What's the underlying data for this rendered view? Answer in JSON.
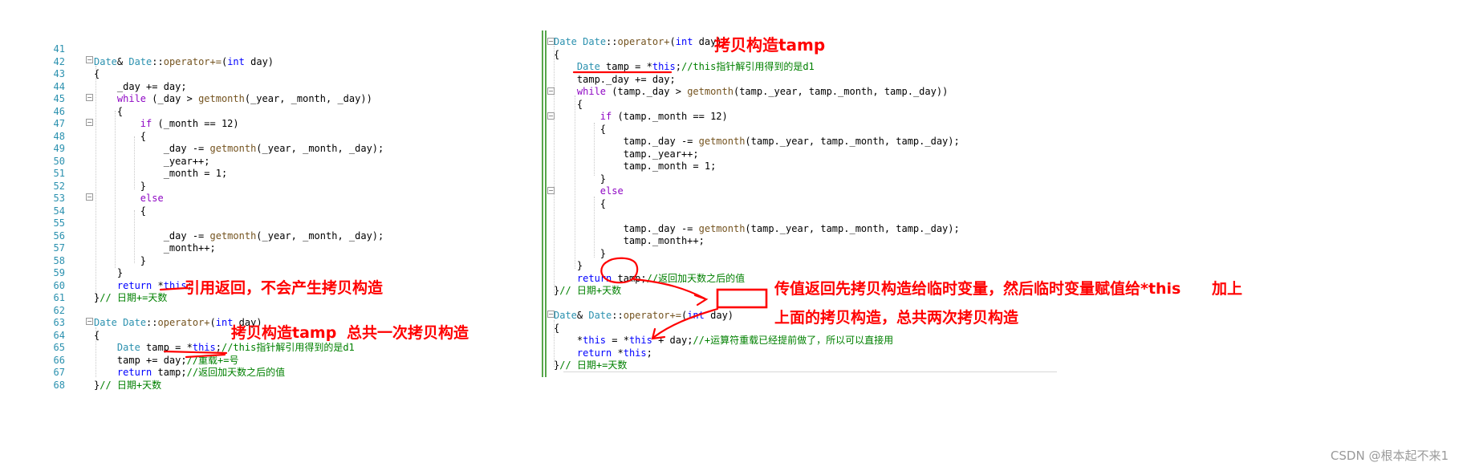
{
  "left": {
    "line_numbers": [
      "41",
      "42",
      "43",
      "44",
      "45",
      "46",
      "47",
      "48",
      "49",
      "50",
      "51",
      "52",
      "53",
      "54",
      "55",
      "56",
      "57",
      "58",
      "59",
      "60",
      "61",
      "62",
      "63",
      "64",
      "65",
      "66",
      "67",
      "68"
    ],
    "code": [
      "",
      "Date& Date::operator+=(int day)",
      "{",
      "    _day += day;",
      "    while (_day > getmonth(_year, _month, _day))",
      "    {",
      "        if (_month == 12)",
      "        {",
      "            _day -= getmonth(_year, _month, _day);",
      "            _year++;",
      "            _month = 1;",
      "        }",
      "        else",
      "        {",
      "",
      "            _day -= getmonth(_year, _month, _day);",
      "            _month++;",
      "        }",
      "    }",
      "    return *this;",
      "}// 日期+=天数",
      "",
      "Date Date::operator+(int day)",
      "{",
      "    Date tamp = *this;//this指针解引用得到的是d1",
      "    tamp += day;//重载+=号",
      "    return tamp;//返回加天数之后的值",
      "}// 日期+天数"
    ]
  },
  "right": {
    "code": [
      "Date Date::operator+(int day)",
      "{",
      "    Date tamp = *this;//this指针解引用得到的是d1",
      "    tamp._day += day;",
      "    while (tamp._day > getmonth(tamp._year, tamp._month, tamp._day))",
      "    {",
      "        if (tamp._month == 12)",
      "        {",
      "            tamp._day -= getmonth(tamp._year, tamp._month, tamp._day);",
      "            tamp._year++;",
      "            tamp._month = 1;",
      "        }",
      "        else",
      "        {",
      "",
      "            tamp._day -= getmonth(tamp._year, tamp._month, tamp._day);",
      "            tamp._month++;",
      "        }",
      "    }",
      "    return tamp;//返回加天数之后的值",
      "}// 日期+天数",
      "",
      "Date& Date::operator+=(int day)",
      "{",
      "    *this = *this + day;//+运算符重载已经提前做了，所以可以直接用",
      "    return *this;",
      "}// 日期+=天数"
    ]
  },
  "annotations": {
    "ref_return": "引用返回，不会产生拷贝构造",
    "copy_tamp_left": "拷贝构造tamp",
    "copy_once": "总共一次拷贝构造",
    "copy_tamp_right": "拷贝构造tamp",
    "value_return_1": "传值返回先拷贝构造给临时变量，然后临时变量赋值给*this",
    "add_up": "加上",
    "value_return_2": "上面的拷贝构造，总共两次拷贝构造"
  },
  "watermark": "CSDN @根本起不来1",
  "colors": {
    "keyword": "#0000ff",
    "control": "#8f08c4",
    "type": "#2b91af",
    "comment": "#008000",
    "annotation": "#ff0000",
    "linenum": "#2b91af"
  }
}
